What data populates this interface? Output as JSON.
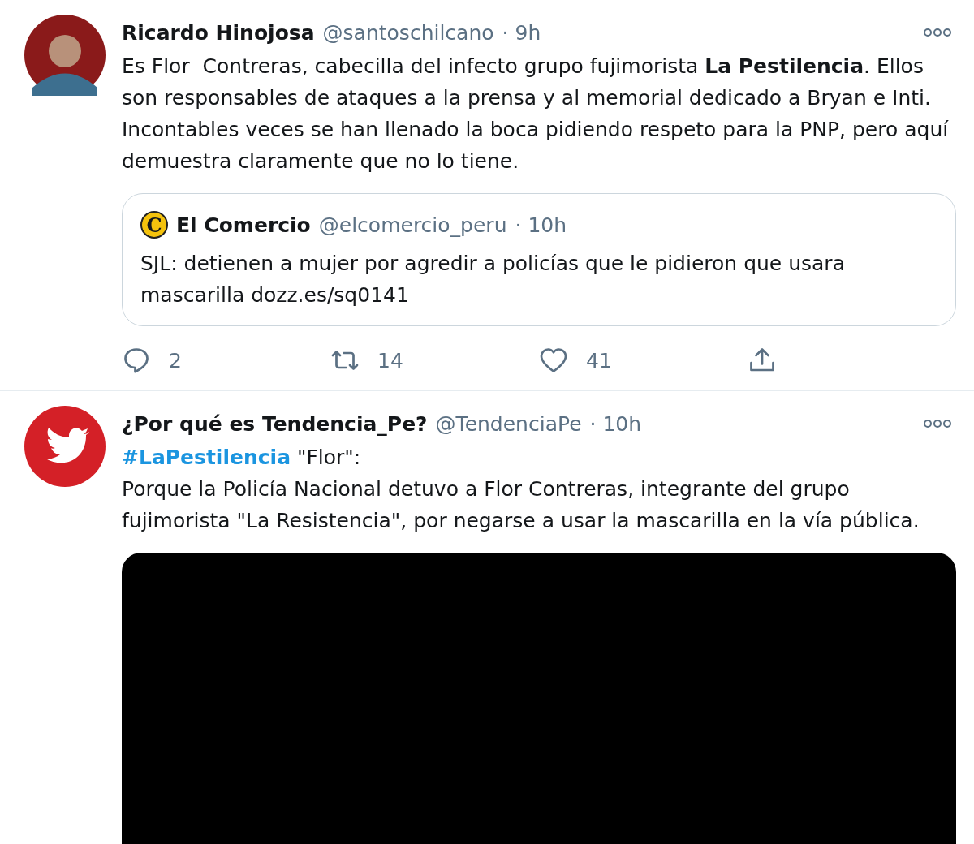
{
  "tweets": [
    {
      "avatar": {
        "kind": "person"
      },
      "name": "Ricardo Hinojosa",
      "handle": "@santoschilcano",
      "time": "· 9h",
      "text": "Es Flor  Contreras, cabecilla del infecto grupo fujimorista **La Pestilencia**. Ellos son responsables de ataques a la prensa y al memorial dedicado a Bryan e Inti. Incontables veces se han llenado la boca pidiendo respeto para la PNP, pero aquí demuestra claramente que no lo tiene.",
      "quote": {
        "logo": "C",
        "name": "El Comercio",
        "handle": "@elcomercio_peru",
        "time": "· 10h",
        "text": "SJL: detienen a mujer por agredir a policías que le pidieron que usara mascarilla dozz.es/sq0141"
      },
      "actions": [
        {
          "kind": "reply",
          "count": "2"
        },
        {
          "kind": "retweet",
          "count": "14"
        },
        {
          "kind": "like",
          "count": "41"
        },
        {
          "kind": "share"
        }
      ]
    },
    {
      "avatar": {
        "kind": "bird"
      },
      "name": "¿Por qué es Tendencia_Pe?",
      "handle": "@TendenciaPe",
      "time": "· 10h",
      "hashtag": "#LaPestilencia",
      "text": " \"Flor\":\nPorque la Policía Nacional detuvo a Flor Contreras, integrante del grupo fujimorista \"La Resistencia\", por negarse a usar la mascarilla en la vía pública.",
      "media": {
        "kind": "video"
      }
    }
  ]
}
